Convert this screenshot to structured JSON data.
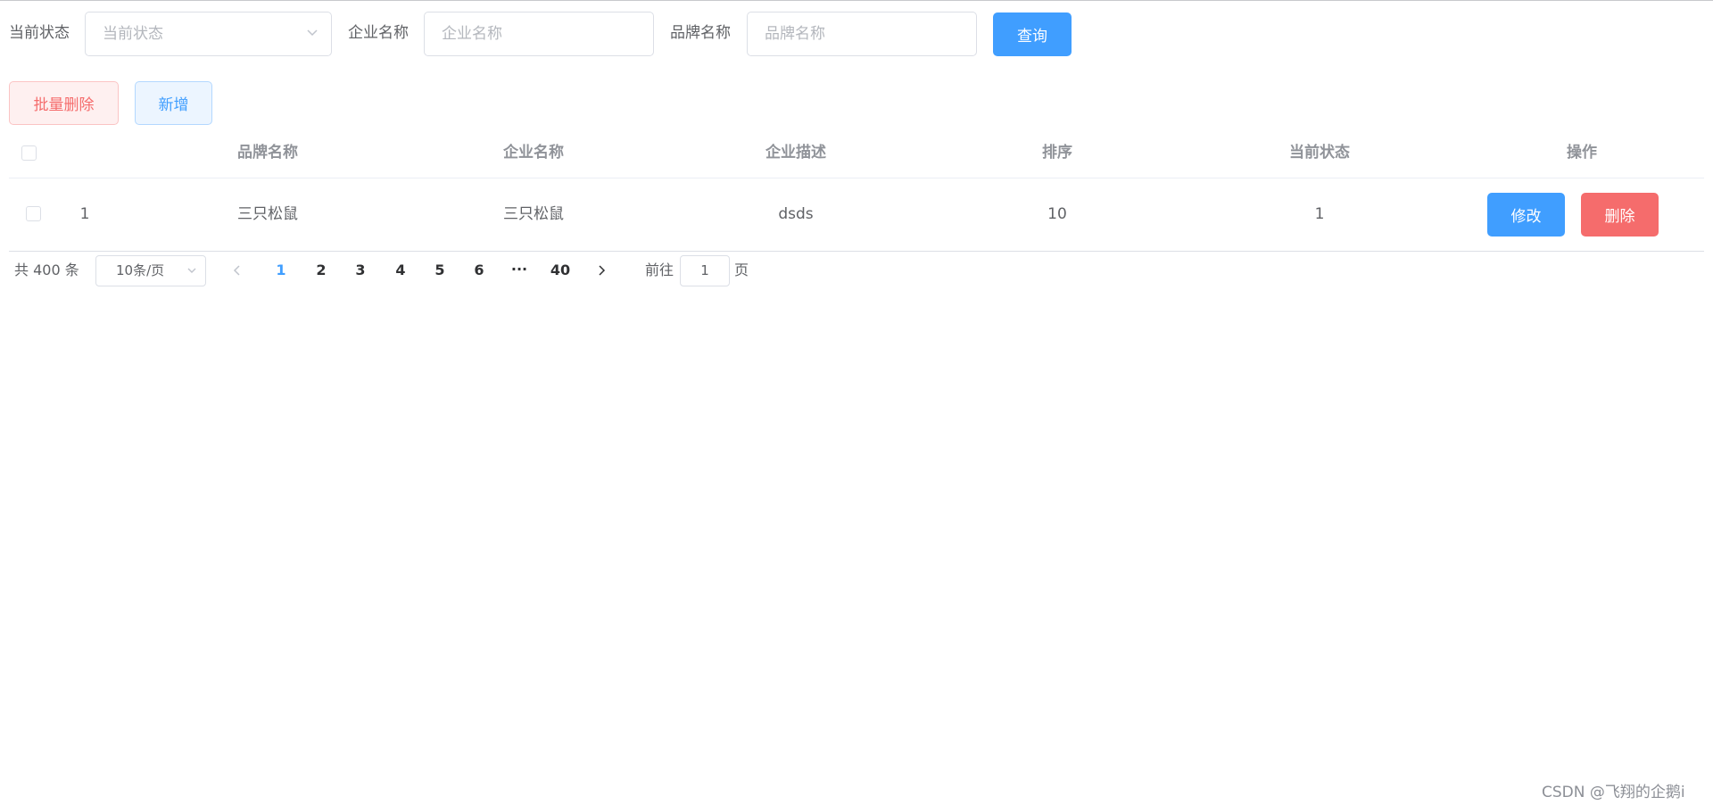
{
  "filters": {
    "status_label": "当前状态",
    "status_placeholder": "当前状态",
    "company_label": "企业名称",
    "company_placeholder": "企业名称",
    "brand_label": "品牌名称",
    "brand_placeholder": "品牌名称",
    "query_button": "查询"
  },
  "actions": {
    "batch_delete": "批量删除",
    "add": "新增"
  },
  "table": {
    "columns": [
      "品牌名称",
      "企业名称",
      "企业描述",
      "排序",
      "当前状态",
      "操作"
    ],
    "rows": [
      {
        "index": "1",
        "brand": "三只松鼠",
        "company": "三只松鼠",
        "description": "dsds",
        "order": "10",
        "status": "1",
        "edit": "修改",
        "delete": "删除"
      }
    ]
  },
  "pagination": {
    "total": "共 400 条",
    "page_size": "10条/页",
    "pages": [
      "1",
      "2",
      "3",
      "4",
      "5",
      "6",
      "···",
      "40"
    ],
    "current_page": "1",
    "goto_prefix": "前往",
    "goto_value": "1",
    "goto_suffix": "页"
  },
  "watermark": "CSDN @飞翔的企鹅i",
  "colors": {
    "primary": "#409eff",
    "danger": "#f56c6c",
    "text": "#606266",
    "header_text": "#909399",
    "border": "#dcdfe6"
  }
}
